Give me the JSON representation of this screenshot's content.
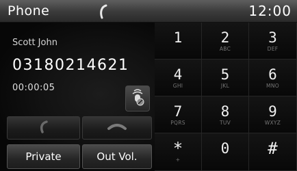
{
  "header": {
    "title": "Phone",
    "call_indicator_icon": "handset-icon",
    "clock": "12:00"
  },
  "call": {
    "name": "Scott John",
    "number": "03180214621",
    "duration": "00:00:05",
    "mute_icon": "microphone-mute-icon"
  },
  "buttons": {
    "answer_icon": "handset-answer-icon",
    "end_icon": "handset-end-icon",
    "private_label": "Private",
    "out_vol_label": "Out Vol."
  },
  "keypad": [
    {
      "digit": "1",
      "letters": ""
    },
    {
      "digit": "2",
      "letters": "ABC"
    },
    {
      "digit": "3",
      "letters": "DEF"
    },
    {
      "digit": "4",
      "letters": "GHI"
    },
    {
      "digit": "5",
      "letters": "JKL"
    },
    {
      "digit": "6",
      "letters": "MNO"
    },
    {
      "digit": "7",
      "letters": "PQRS"
    },
    {
      "digit": "8",
      "letters": "TUV"
    },
    {
      "digit": "9",
      "letters": "WXYZ"
    },
    {
      "digit": "*",
      "letters": "+"
    },
    {
      "digit": "0",
      "letters": ""
    },
    {
      "digit": "#",
      "letters": ""
    }
  ]
}
